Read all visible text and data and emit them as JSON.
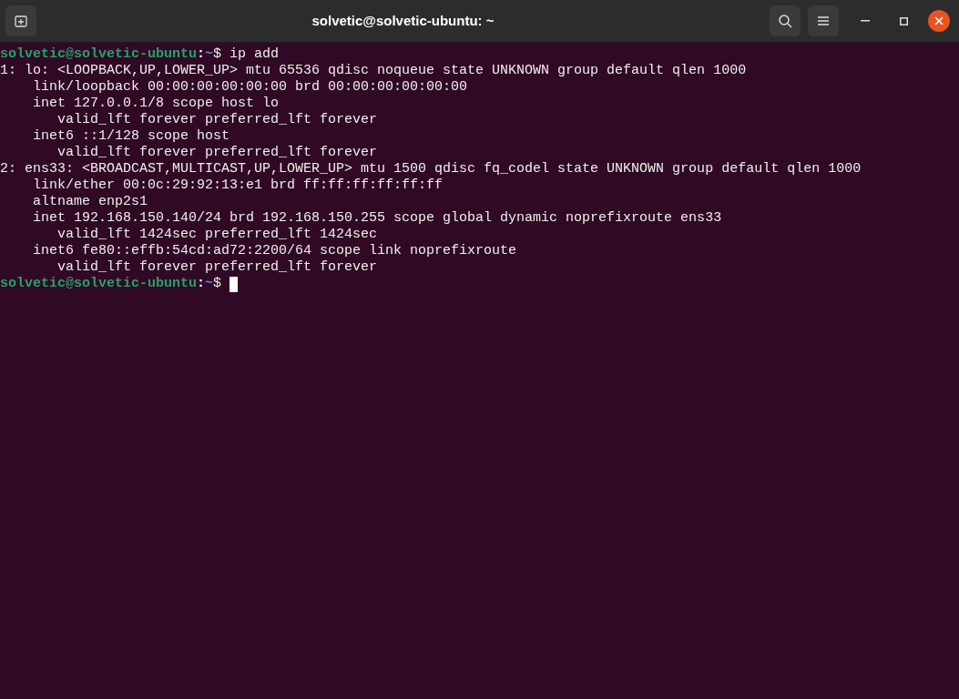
{
  "window": {
    "title": "solvetic@solvetic-ubuntu: ~"
  },
  "terminal": {
    "lines": [
      {
        "kind": "prompt",
        "user_host": "solvetic@solvetic-ubuntu",
        "separator": ":",
        "path": "~",
        "symbol": "$ ",
        "command": "ip add",
        "cursor": false
      },
      {
        "kind": "output",
        "text": "1: lo: <LOOPBACK,UP,LOWER_UP> mtu 65536 qdisc noqueue state UNKNOWN group default qlen 1000"
      },
      {
        "kind": "output",
        "text": "    link/loopback 00:00:00:00:00:00 brd 00:00:00:00:00:00"
      },
      {
        "kind": "output",
        "text": "    inet 127.0.0.1/8 scope host lo"
      },
      {
        "kind": "output",
        "text": "       valid_lft forever preferred_lft forever"
      },
      {
        "kind": "output",
        "text": "    inet6 ::1/128 scope host"
      },
      {
        "kind": "output",
        "text": "       valid_lft forever preferred_lft forever"
      },
      {
        "kind": "output",
        "text": "2: ens33: <BROADCAST,MULTICAST,UP,LOWER_UP> mtu 1500 qdisc fq_codel state UNKNOWN group default qlen 1000"
      },
      {
        "kind": "output",
        "text": "    link/ether 00:0c:29:92:13:e1 brd ff:ff:ff:ff:ff:ff"
      },
      {
        "kind": "output",
        "text": "    altname enp2s1"
      },
      {
        "kind": "output",
        "text": "    inet 192.168.150.140/24 brd 192.168.150.255 scope global dynamic noprefixroute ens33"
      },
      {
        "kind": "output",
        "text": "       valid_lft 1424sec preferred_lft 1424sec"
      },
      {
        "kind": "output",
        "text": "    inet6 fe80::effb:54cd:ad72:2200/64 scope link noprefixroute"
      },
      {
        "kind": "output",
        "text": "       valid_lft forever preferred_lft forever"
      },
      {
        "kind": "prompt",
        "user_host": "solvetic@solvetic-ubuntu",
        "separator": ":",
        "path": "~",
        "symbol": "$ ",
        "cursor": true
      }
    ]
  }
}
